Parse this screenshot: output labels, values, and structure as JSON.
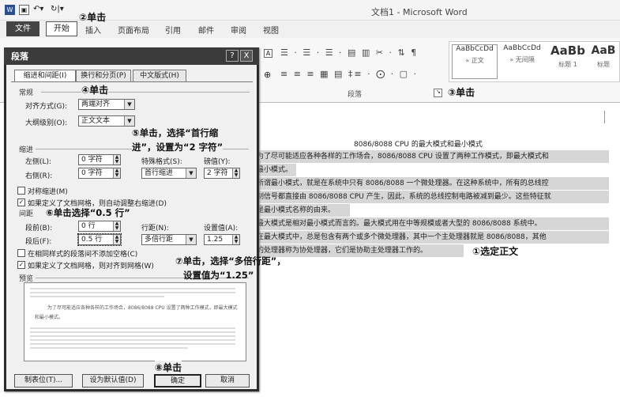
{
  "titlebar": {
    "word_icon": "W",
    "doc_title": "文档1 - Microsoft Word"
  },
  "ribbon": {
    "tabs": [
      "文件",
      "开始",
      "插入",
      "页面布局",
      "引用",
      "邮件",
      "审阅",
      "视图"
    ],
    "para_group_label": "段落",
    "toolbar_row1": "☰ · ☰ · ☰ · ▤ ▥ ✂ · ⇅ ¶",
    "toolbar_row2": "≡ ≡ ≡ ▦ ▤ ‡≡ · ⨀ · ▢ ·",
    "styles": [
      {
        "preview": "AaBbCcDd",
        "name": "» 正文"
      },
      {
        "preview": "AaBbCcDd",
        "name": "» 无间隔"
      },
      {
        "preview": "AaBb",
        "name": "标题 1"
      },
      {
        "preview": "AaB",
        "name": "标题"
      }
    ]
  },
  "dialog": {
    "title": "段落",
    "help": "?",
    "close": "X",
    "tabs": [
      "缩进和间距(I)",
      "换行和分页(P)",
      "中文版式(H)"
    ],
    "general": {
      "section": "常规",
      "align_label": "对齐方式(G):",
      "align_value": "两端对齐",
      "outline_label": "大纲级别(O):",
      "outline_value": "正文文本"
    },
    "indent": {
      "section": "缩进",
      "left_label": "左侧(L):",
      "left_value": "0 字符",
      "right_label": "右侧(R):",
      "right_value": "0 字符",
      "special_label": "特殊格式(S):",
      "special_value": "首行缩进",
      "by_label": "磅值(Y):",
      "by_value": "2 字符",
      "mirror_label": "对称缩进(M)",
      "grid_label": "如果定义了文档网格，则自动调整右缩进(D)"
    },
    "spacing": {
      "section": "间距",
      "before_label": "段前(B):",
      "before_value": "0 行",
      "after_label": "段后(F):",
      "after_value": "0.5 行",
      "line_label": "行距(N):",
      "line_value": "多倍行距",
      "at_label": "设置值(A):",
      "at_value": "1.25",
      "nospace_label": "在相同样式的段落间不添加空格(C)",
      "snap_label": "如果定义了文档网格，则对齐到网格(W)"
    },
    "preview": {
      "section": "预览",
      "sample1": "为了尽可能适应各种各样的工作场合，8086/8088 CPU 设置了两种工作模式，即最大模式",
      "sample2": "和最小模式。"
    },
    "buttons": {
      "tabs": "制表位(T)...",
      "default": "设为默认值(D)",
      "ok": "确定",
      "cancel": "取消"
    }
  },
  "document": {
    "heading": "8086/8088 CPU 的最大模式和最小模式",
    "lines": [
      "为了尽可能适应各种各样的工作场合，8086/8088 CPU 设置了两种工作模式，即最大模式和",
      "最小模式。",
      "所谓最小模式，就是在系统中只有 8086/8088 一个微处理器。在这种系统中，所有的总线控",
      "制信号都直接由 8086/8088 CPU 产生，因此，系统的总线控制电路被减到最少。这些特征就",
      "是最小模式名称的由来。",
      "最大模式是相对最小模式而言的。最大模式用在中等规模或者大型的 8086/8088 系统中。",
      "在最大模式中，总是包含有两个或多个微处理器，其中一个主处理器就是 8086/8088，其他",
      "的处理器称为协处理器，它们是协助主处理器工作的。"
    ]
  },
  "annotations": {
    "a1": "①选定正文",
    "a2": "②单击",
    "a3": "③单击",
    "a4": "④单击",
    "a5_l1": "⑤单击，选择“首行缩",
    "a5_l2": "进”，设置为“2 字符”",
    "a6": "⑥单击选择“0.5 行”",
    "a7_l1": "⑦单击，选择“多倍行距”，",
    "a7_l2": "设置值为“1.25”",
    "a8": "⑧单击"
  }
}
